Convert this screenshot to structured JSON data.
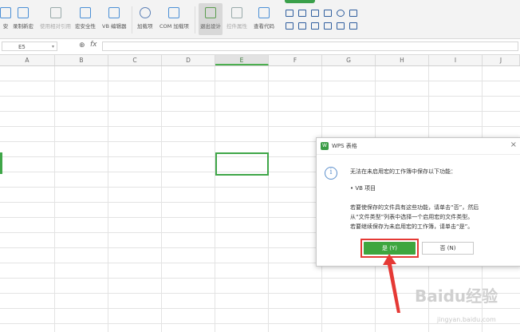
{
  "ribbon": {
    "buttons": [
      {
        "label": "安",
        "icon": "macro-icon"
      },
      {
        "label": "录制新宏",
        "icon": "record-macro-icon"
      },
      {
        "label": "使用相对引用",
        "icon": "relative-ref-icon",
        "disabled": true
      },
      {
        "label": "宏安全性",
        "icon": "macro-security-icon"
      },
      {
        "label": "VB 编辑器",
        "icon": "vb-editor-icon"
      },
      {
        "label": "加载项",
        "icon": "addins-icon"
      },
      {
        "label": "COM 加载项",
        "icon": "com-addins-icon"
      },
      {
        "label": "退出设计",
        "icon": "design-mode-icon",
        "active": true
      },
      {
        "label": "控件属性",
        "icon": "control-properties-icon",
        "disabled": true
      },
      {
        "label": "查看代码",
        "icon": "view-code-icon"
      }
    ]
  },
  "formula_bar": {
    "name_box": "E5",
    "fx": "fx"
  },
  "columns": [
    "A",
    "B",
    "C",
    "D",
    "E",
    "F",
    "G",
    "H",
    "I",
    "J"
  ],
  "selected_column": "E",
  "dialog": {
    "title": "WPS 表格",
    "app_logo": "W",
    "close": "×",
    "info_glyph": "i",
    "message_1": "无法在未启用宏的工作簿中保存以下功能：",
    "message_2": "• VB 项目",
    "message_3": "若要使保存的文件具有这些功能，请单击“否”，然后",
    "message_4": "从“文件类型”列表中选择一个启用宏的文件类型。",
    "message_5": "若要继续保存为未启用宏的工作簿，请单击“是”。",
    "yes_label": "是 (Y)",
    "no_label": "否 (N)"
  },
  "watermark": {
    "logo": "Baidu经验",
    "url": "jingyan.baidu.com"
  },
  "colors": {
    "accent_green": "#3ea63f",
    "highlight_red": "#e53935"
  }
}
